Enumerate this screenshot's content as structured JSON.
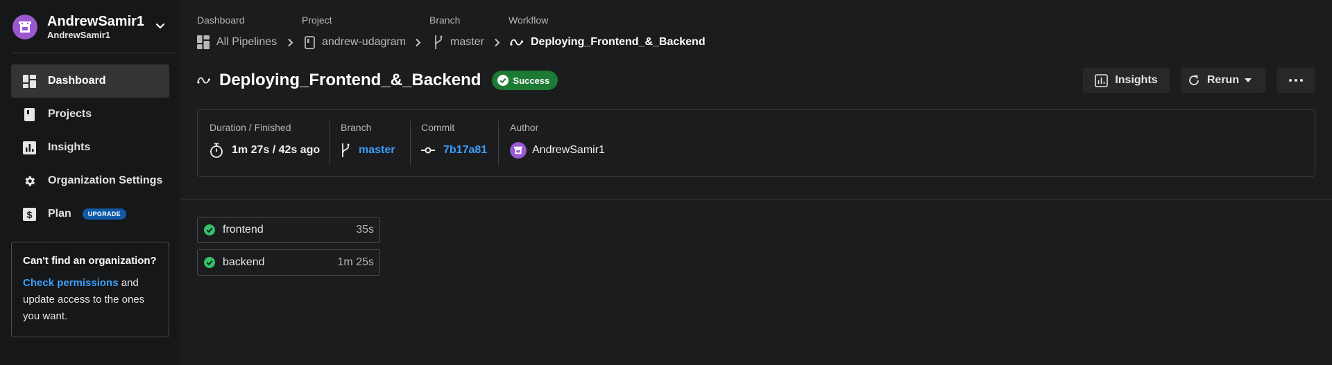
{
  "org": {
    "name": "AndrewSamir1",
    "sub": "AndrewSamir1",
    "avatar_colors": [
      "#9b59d0",
      "#ffffff"
    ]
  },
  "nav": [
    {
      "label": "Dashboard",
      "icon": "dashboard-icon",
      "active": true
    },
    {
      "label": "Projects",
      "icon": "projects-icon"
    },
    {
      "label": "Insights",
      "icon": "insights-icon"
    },
    {
      "label": "Organization Settings",
      "icon": "gear-icon"
    },
    {
      "label": "Plan",
      "icon": "dollar-icon",
      "badge": "UPGRADE"
    }
  ],
  "org_card": {
    "title": "Can't find an organization?",
    "link": "Check permissions",
    "text": " and update access to the ones you want."
  },
  "breadcrumb": {
    "labels": [
      "Dashboard",
      "Project",
      "Branch",
      "Workflow"
    ],
    "items": [
      "All Pipelines",
      "andrew-udagram",
      "master",
      "Deploying_Frontend_&_Backend"
    ]
  },
  "workflow": {
    "name": "Deploying_Frontend_&_Backend",
    "status": "Success"
  },
  "actions": {
    "insights": "Insights",
    "rerun": "Rerun"
  },
  "info": {
    "duration_label": "Duration / Finished",
    "duration_value": "1m 27s / 42s ago",
    "branch_label": "Branch",
    "branch_value": "master",
    "commit_label": "Commit",
    "commit_value": "7b17a81",
    "author_label": "Author",
    "author_value": "AndrewSamir1"
  },
  "jobs": [
    {
      "name": "frontend",
      "duration": "35s",
      "status": "success"
    },
    {
      "name": "backend",
      "duration": "1m 25s",
      "status": "success"
    }
  ],
  "colors": {
    "accent": "#3aa0ff",
    "success": "#1d7a35",
    "success_check": "#34c16a",
    "upgrade": "#0f5aa8"
  }
}
